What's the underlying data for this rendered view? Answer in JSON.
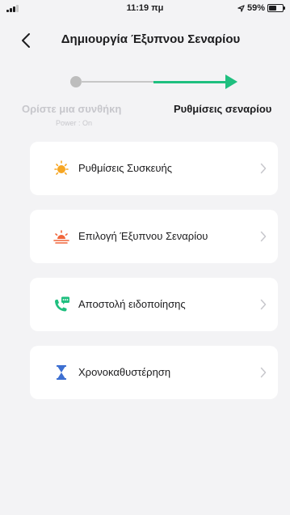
{
  "status_bar": {
    "time": "11:19 πμ",
    "battery": "59%",
    "battery_level": 0.59,
    "location_icon": "location-arrow-icon",
    "signal_icon": "signal-bars-icon"
  },
  "nav": {
    "title": "Δημιουργία Έξυπνου Σεναρίου",
    "back_icon": "chevron-left-icon"
  },
  "steps": {
    "step1_label": "Ορίστε μια συνθήκη",
    "step1_sub": "Power : On",
    "step2_label": "Ρυθμίσεις σεναρίου",
    "accent_color": "#1fbf7f"
  },
  "menu": [
    {
      "label": "Ρυθμίσεις Συσκευής",
      "icon": "sun-icon",
      "color": "#f6a623"
    },
    {
      "label": "Επιλογή Έξυπνου Σεναρίου",
      "icon": "sunset-icon",
      "color": "#f0653a"
    },
    {
      "label": "Αποστολή ειδοποίησης",
      "icon": "phone-message-icon",
      "color": "#1fbf7f"
    },
    {
      "label": "Χρονοκαθυστέρηση",
      "icon": "hourglass-icon",
      "color": "#3d6fd1"
    }
  ]
}
